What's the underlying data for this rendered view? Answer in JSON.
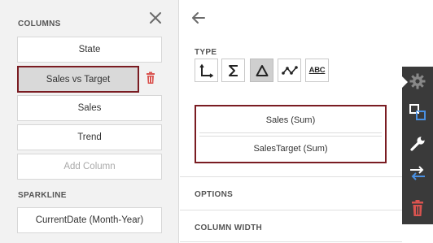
{
  "columns": {
    "title": "COLUMNS",
    "items": [
      "State",
      "Sales vs Target",
      "Sales",
      "Trend"
    ],
    "add_label": "Add Column"
  },
  "sparkline": {
    "title": "SPARKLINE",
    "value": "CurrentDate (Month-Year)"
  },
  "details": {
    "type_label": "TYPE",
    "type_buttons": [
      "dimension-icon",
      "sum-icon",
      "delta-icon",
      "sparkline-icon",
      "abc-icon"
    ],
    "abc_text": "ABC",
    "active_type": "delta-icon",
    "values": [
      "Sales (Sum)",
      "SalesTarget (Sum)"
    ],
    "options_label": "OPTIONS",
    "column_width_label": "COLUMN WIDTH"
  },
  "toolbar": {
    "icons": [
      "gear-icon",
      "binding-icon",
      "wrench-icon",
      "swap-icon",
      "trash-icon"
    ]
  },
  "colors": {
    "highlight_border": "#7a1c22",
    "delete_red": "#d9534f",
    "toolbar_bg": "#3a3a3a",
    "accent_blue": "#4a90e2"
  }
}
